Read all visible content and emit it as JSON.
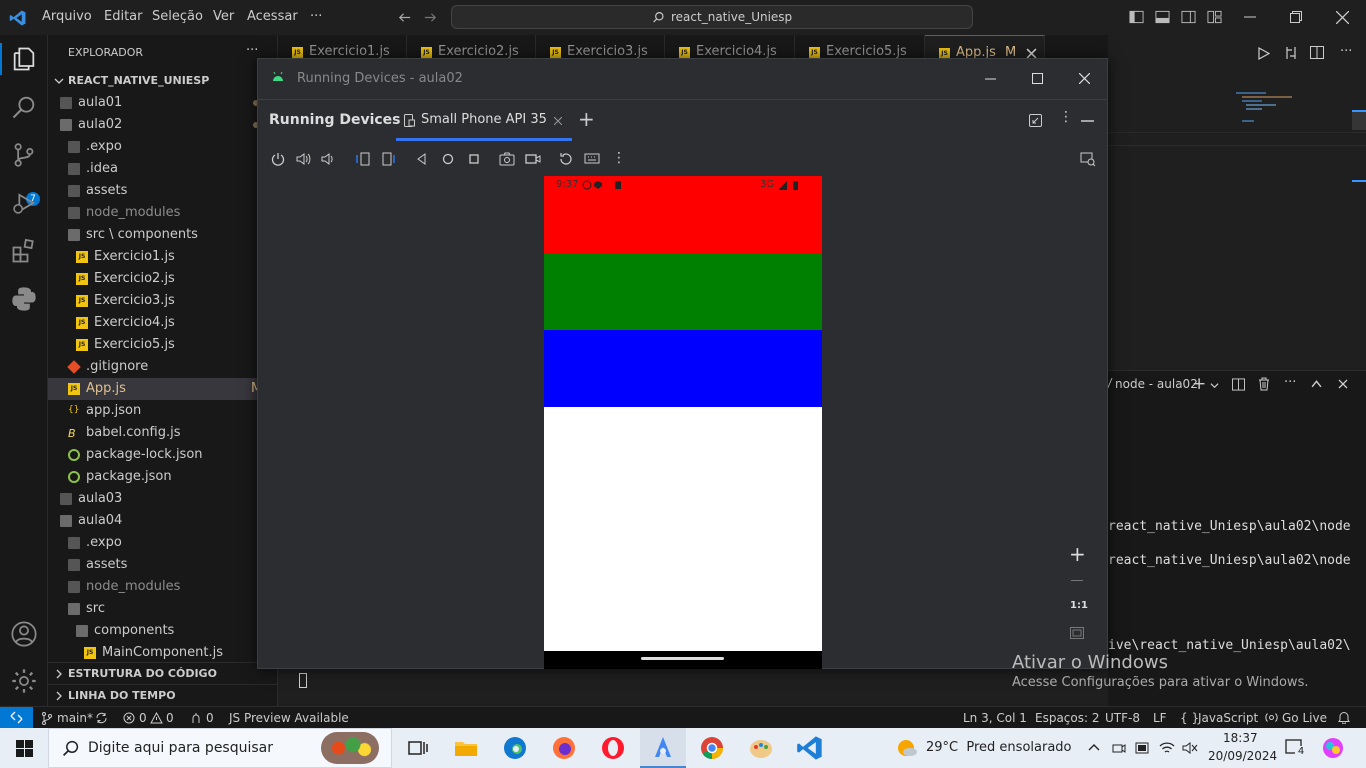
{
  "titlebar": {
    "menus": [
      "Arquivo",
      "Editar",
      "Seleção",
      "Ver",
      "Acessar",
      "···"
    ],
    "search": "react_native_Uniesp"
  },
  "explorer": {
    "header": "EXPLORADOR",
    "header_more": "···",
    "root": "REACT_NATIVE_UNIESP",
    "items": [
      {
        "label": "aula01",
        "depth": 0,
        "kind": "folder",
        "icon": "folder-icon"
      },
      {
        "label": "aula02",
        "depth": 0,
        "kind": "folder-open",
        "icon": "folder-open-icon"
      },
      {
        "label": ".expo",
        "depth": 1,
        "kind": "folder",
        "icon": "expo-folder-icon"
      },
      {
        "label": ".idea",
        "depth": 1,
        "kind": "folder",
        "icon": "idea-folder-icon"
      },
      {
        "label": "assets",
        "depth": 1,
        "kind": "folder",
        "icon": "assets-folder-icon"
      },
      {
        "label": "node_modules",
        "depth": 1,
        "kind": "folder",
        "icon": "node-folder-icon",
        "dim": true
      },
      {
        "label": "src \\ components",
        "depth": 1,
        "kind": "folder-open",
        "icon": "components-folder-icon"
      },
      {
        "label": "Exercicio1.js",
        "depth": 2,
        "kind": "js",
        "icon": "js-file-icon"
      },
      {
        "label": "Exercicio2.js",
        "depth": 2,
        "kind": "js",
        "icon": "js-file-icon"
      },
      {
        "label": "Exercicio3.js",
        "depth": 2,
        "kind": "js",
        "icon": "js-file-icon"
      },
      {
        "label": "Exercicio4.js",
        "depth": 2,
        "kind": "js",
        "icon": "js-file-icon"
      },
      {
        "label": "Exercicio5.js",
        "depth": 2,
        "kind": "js",
        "icon": "js-file-icon"
      },
      {
        "label": ".gitignore",
        "depth": 1,
        "kind": "git",
        "icon": "git-file-icon"
      },
      {
        "label": "App.js",
        "depth": 1,
        "kind": "js",
        "icon": "js-file-icon",
        "selected": true,
        "badge": "M"
      },
      {
        "label": "app.json",
        "depth": 1,
        "kind": "json",
        "icon": "json-file-icon"
      },
      {
        "label": "babel.config.js",
        "depth": 1,
        "kind": "babel",
        "icon": "babel-file-icon"
      },
      {
        "label": "package-lock.json",
        "depth": 1,
        "kind": "npm",
        "icon": "npm-file-icon"
      },
      {
        "label": "package.json",
        "depth": 1,
        "kind": "npm",
        "icon": "npm-file-icon"
      },
      {
        "label": "aula03",
        "depth": 0,
        "kind": "folder",
        "icon": "folder-icon"
      },
      {
        "label": "aula04",
        "depth": 0,
        "kind": "folder-open",
        "icon": "folder-open-icon"
      },
      {
        "label": ".expo",
        "depth": 1,
        "kind": "folder",
        "icon": "expo-folder-icon"
      },
      {
        "label": "assets",
        "depth": 1,
        "kind": "folder",
        "icon": "assets-folder-icon"
      },
      {
        "label": "node_modules",
        "depth": 1,
        "kind": "folder",
        "icon": "node-folder-icon",
        "dim": true
      },
      {
        "label": "src",
        "depth": 1,
        "kind": "folder-open",
        "icon": "src-folder-icon"
      },
      {
        "label": "components",
        "depth": 2,
        "kind": "folder-open",
        "icon": "components-folder-icon"
      },
      {
        "label": "MainComponent.js",
        "depth": 3,
        "kind": "js",
        "icon": "js-file-icon"
      }
    ],
    "outline": "ESTRUTURA DO CÓDIGO",
    "timeline": "LINHA DO TEMPO"
  },
  "editor_tabs": [
    "Exercicio1.js",
    "Exercicio2.js",
    "Exercicio3.js",
    "Exercicio4.js",
    "Exercicio5.js",
    "App.js"
  ],
  "editor_active_badge": "M",
  "activity_badge": "7",
  "terminal": {
    "title": "node - aula02",
    "lines": [
      "react_native_Uniesp\\aula02\\node",
      "react_native_Uniesp\\aula02\\node",
      "ive\\react_native_Uniesp\\aula02\\"
    ]
  },
  "running_devices": {
    "window_title": "Running Devices - aula02",
    "panel_title": "Running Devices",
    "device_tab": "Small Phone API 35",
    "zoom_label": "1:1",
    "phone": {
      "time": "9:37",
      "network": "3G",
      "stripes": [
        {
          "name": "red-band",
          "color": "#ff0000"
        },
        {
          "name": "green-band",
          "color": "#008000"
        },
        {
          "name": "blue-band",
          "color": "#0000ff"
        }
      ],
      "background": "#ffffff"
    }
  },
  "watermark": {
    "title": "Ativar o Windows",
    "subtitle": "Acesse Configurações para ativar o Windows."
  },
  "statusbar": {
    "branch": "main*",
    "errors": "0",
    "warnings": "0",
    "ports": "0",
    "js_preview": "JS Preview Available",
    "position": "Ln 3, Col 1",
    "spaces": "Espaços: 2",
    "encoding": "UTF-8",
    "eol": "LF",
    "language": "JavaScript",
    "golive": "Go Live"
  },
  "taskbar": {
    "search_placeholder": "Digite aqui para pesquisar",
    "weather": "29°C  Pred ensolarado",
    "time": "18:37",
    "date": "20/09/2024",
    "notifications": "4"
  }
}
